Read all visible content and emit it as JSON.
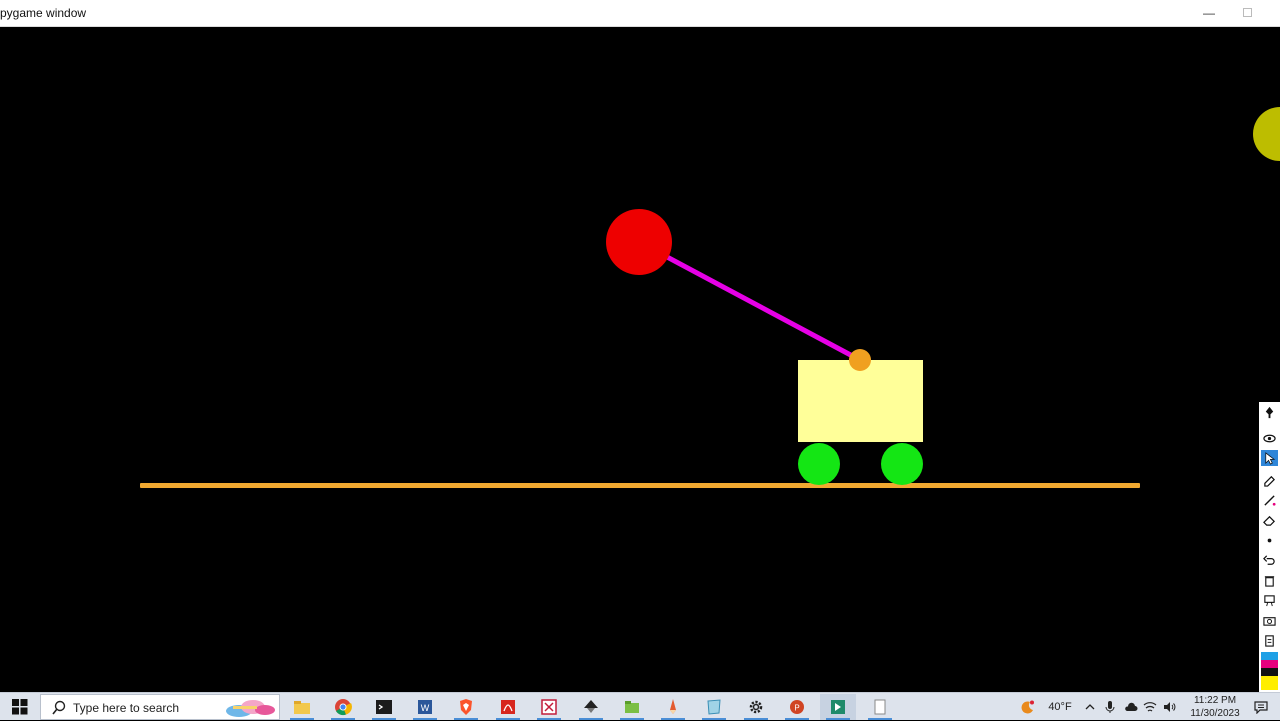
{
  "window": {
    "title": "pygame window",
    "minimize_label": "—"
  },
  "scene": {
    "background": "#000000",
    "track_color": "#F0A830",
    "cart_color": "#FFFF99",
    "wheel_color": "#14E614",
    "rod_color": "#E600E6",
    "pivot_color": "#F0A020",
    "bob_color": "#EE0000",
    "cursor_color": "#BDBD00"
  },
  "annotator": {
    "tools": [
      {
        "icon": "pen-icon"
      },
      {
        "icon": "eye-icon"
      },
      {
        "icon": "cursor-icon",
        "active": true
      },
      {
        "icon": "highlighter-icon"
      },
      {
        "icon": "line-icon"
      },
      {
        "icon": "eraser-icon"
      },
      {
        "icon": "dot-icon"
      },
      {
        "icon": "undo-icon"
      },
      {
        "icon": "trash-icon"
      },
      {
        "icon": "board-icon"
      },
      {
        "icon": "camera-icon"
      },
      {
        "icon": "clipboard-icon"
      }
    ],
    "colors": [
      "#1EA0E6",
      "#E6007E",
      "#111111",
      "#FFEE00"
    ]
  },
  "taskbar": {
    "search_placeholder": "Type here to search",
    "apps": [
      {
        "icon": "file-explorer-icon"
      },
      {
        "icon": "chrome-icon"
      },
      {
        "icon": "terminal-icon"
      },
      {
        "icon": "word-icon"
      },
      {
        "icon": "brave-icon"
      },
      {
        "icon": "acrobat-icon"
      },
      {
        "icon": "snipping-tool-icon"
      },
      {
        "icon": "inkscape-icon"
      },
      {
        "icon": "folder-app-icon"
      },
      {
        "icon": "pencil-app-icon"
      },
      {
        "icon": "notepad-icon"
      },
      {
        "icon": "settings-icon"
      },
      {
        "icon": "powerpoint-icon"
      },
      {
        "icon": "python-app-icon"
      },
      {
        "icon": "blank-document-icon"
      }
    ]
  },
  "tray": {
    "temperature": "40°F",
    "time": "11:22 PM",
    "date": "11/30/2023"
  }
}
